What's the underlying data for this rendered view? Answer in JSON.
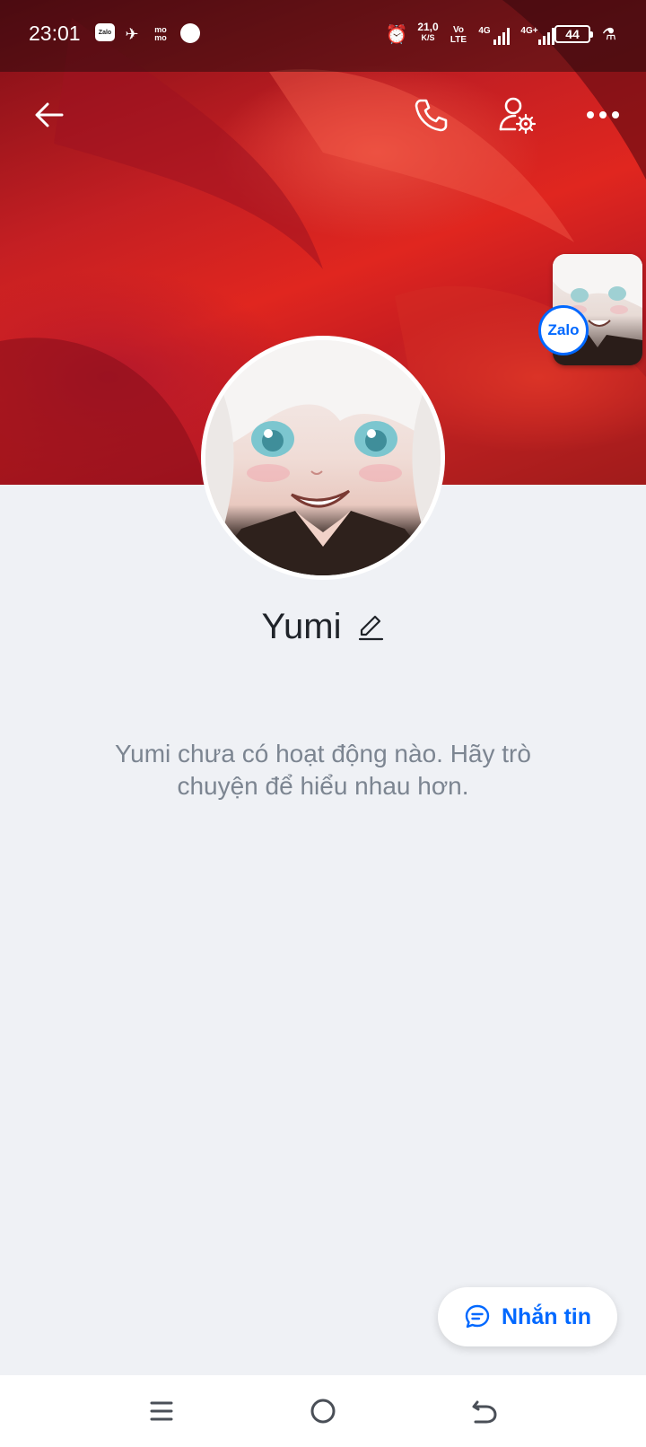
{
  "status_bar": {
    "time": "23:01",
    "zalo_icon_text": "Zalo",
    "momo_line1": "mo",
    "momo_line2": "mo",
    "speed_value": "21,0",
    "speed_unit": "K/S",
    "volte_line1": "Vo",
    "volte_line2": "LTE",
    "net1": "4G",
    "net2": "4G+",
    "battery": "44"
  },
  "header": {
    "icons": [
      "arrow-left-icon",
      "phone-icon",
      "user-settings-icon",
      "more-icon"
    ]
  },
  "floating_bubble": {
    "badge": "Zalo"
  },
  "profile": {
    "name": "Yumi",
    "empty_message": "Yumi chưa có hoạt động nào. Hãy trò chuyện để hiểu nhau hơn."
  },
  "chat_button": {
    "label": "Nhắn tin"
  },
  "colors": {
    "accent": "#0068ff",
    "background": "#eff1f5",
    "name_text": "#1f2329",
    "muted_text": "#7c8591"
  }
}
